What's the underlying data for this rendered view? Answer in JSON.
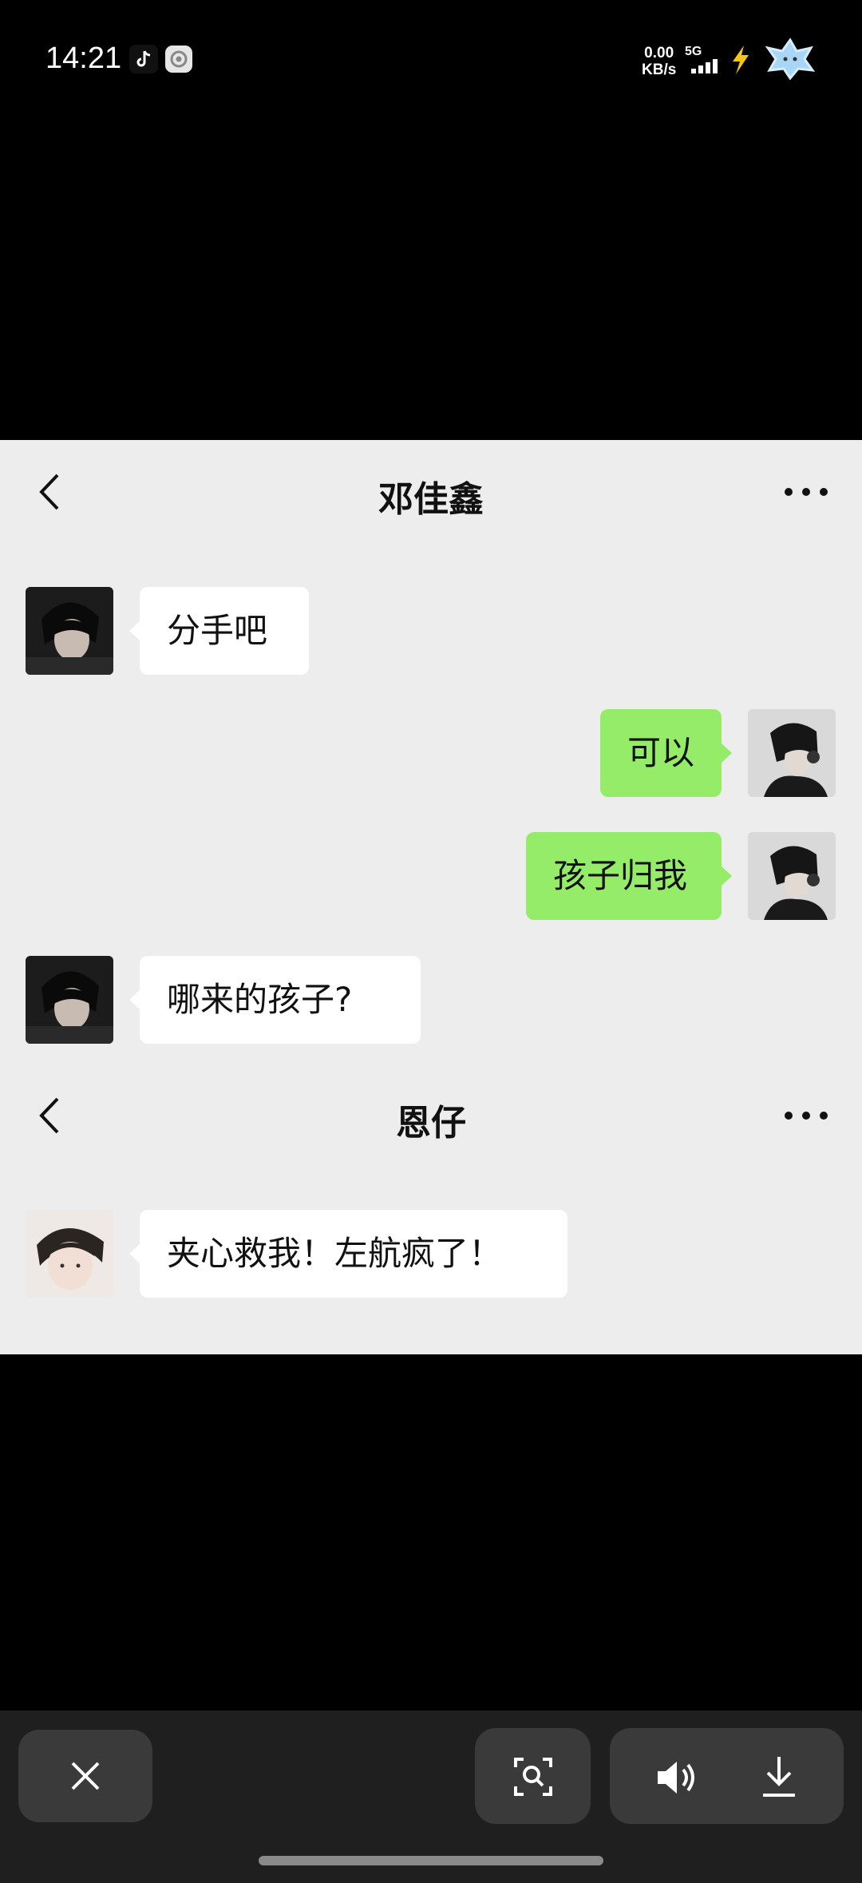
{
  "status_bar": {
    "time": "14:21",
    "net_speed_value": "0.00",
    "net_speed_unit": "KB/s",
    "signal_label": "5G",
    "icons": [
      "tiktok-icon",
      "settings-app-icon",
      "signal-icon",
      "charging-bolt-icon",
      "pet-sticker-icon"
    ]
  },
  "chats": [
    {
      "header": {
        "title": "邓佳鑫",
        "back_icon": "chevron-left-icon",
        "more_icon": "more-dots-icon"
      },
      "messages": [
        {
          "side": "in",
          "text": "分手吧"
        },
        {
          "side": "out",
          "text": "可以"
        },
        {
          "side": "out",
          "text": "孩子归我"
        },
        {
          "side": "in",
          "text": "哪来的孩子?"
        }
      ]
    },
    {
      "header": {
        "title": "恩仔",
        "back_icon": "chevron-left-icon",
        "more_icon": "more-dots-icon"
      },
      "messages": [
        {
          "side": "in",
          "text": "夹心救我！左航疯了！"
        }
      ]
    }
  ],
  "toolbar": {
    "close_icon": "close-icon",
    "image_search_icon": "image-search-icon",
    "volume_icon": "volume-icon",
    "download_icon": "download-icon"
  },
  "colors": {
    "chat_background": "#ededed",
    "incoming_bubble": "#ffffff",
    "outgoing_bubble": "#95ec69",
    "toolbar_background": "#1f1f1f",
    "toolbar_button": "#3a3a3a"
  }
}
